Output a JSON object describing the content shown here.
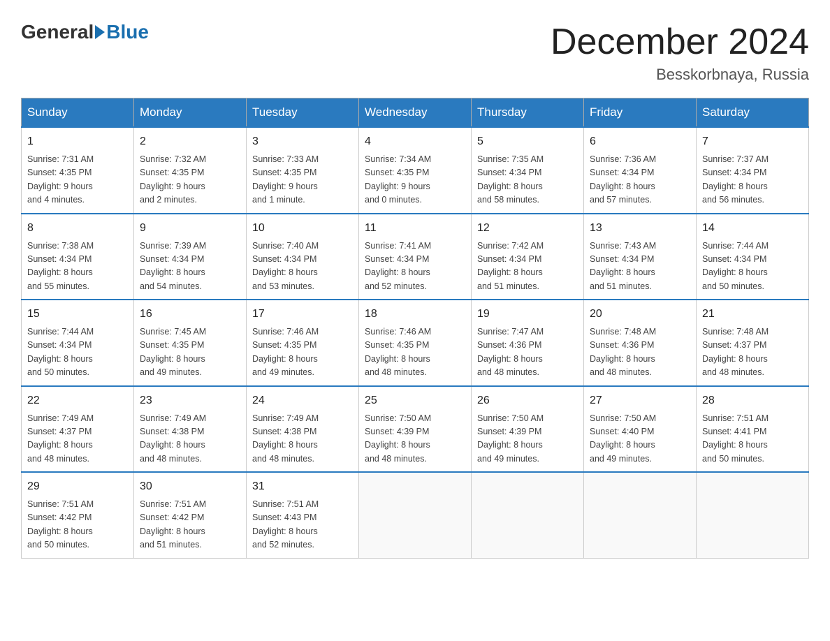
{
  "header": {
    "logo_general": "General",
    "logo_blue": "Blue",
    "month_title": "December 2024",
    "location": "Besskorbnaya, Russia"
  },
  "days_of_week": [
    "Sunday",
    "Monday",
    "Tuesday",
    "Wednesday",
    "Thursday",
    "Friday",
    "Saturday"
  ],
  "weeks": [
    [
      {
        "day": "1",
        "sunrise": "7:31 AM",
        "sunset": "4:35 PM",
        "daylight": "9 hours and 4 minutes."
      },
      {
        "day": "2",
        "sunrise": "7:32 AM",
        "sunset": "4:35 PM",
        "daylight": "9 hours and 2 minutes."
      },
      {
        "day": "3",
        "sunrise": "7:33 AM",
        "sunset": "4:35 PM",
        "daylight": "9 hours and 1 minute."
      },
      {
        "day": "4",
        "sunrise": "7:34 AM",
        "sunset": "4:35 PM",
        "daylight": "9 hours and 0 minutes."
      },
      {
        "day": "5",
        "sunrise": "7:35 AM",
        "sunset": "4:34 PM",
        "daylight": "8 hours and 58 minutes."
      },
      {
        "day": "6",
        "sunrise": "7:36 AM",
        "sunset": "4:34 PM",
        "daylight": "8 hours and 57 minutes."
      },
      {
        "day": "7",
        "sunrise": "7:37 AM",
        "sunset": "4:34 PM",
        "daylight": "8 hours and 56 minutes."
      }
    ],
    [
      {
        "day": "8",
        "sunrise": "7:38 AM",
        "sunset": "4:34 PM",
        "daylight": "8 hours and 55 minutes."
      },
      {
        "day": "9",
        "sunrise": "7:39 AM",
        "sunset": "4:34 PM",
        "daylight": "8 hours and 54 minutes."
      },
      {
        "day": "10",
        "sunrise": "7:40 AM",
        "sunset": "4:34 PM",
        "daylight": "8 hours and 53 minutes."
      },
      {
        "day": "11",
        "sunrise": "7:41 AM",
        "sunset": "4:34 PM",
        "daylight": "8 hours and 52 minutes."
      },
      {
        "day": "12",
        "sunrise": "7:42 AM",
        "sunset": "4:34 PM",
        "daylight": "8 hours and 51 minutes."
      },
      {
        "day": "13",
        "sunrise": "7:43 AM",
        "sunset": "4:34 PM",
        "daylight": "8 hours and 51 minutes."
      },
      {
        "day": "14",
        "sunrise": "7:44 AM",
        "sunset": "4:34 PM",
        "daylight": "8 hours and 50 minutes."
      }
    ],
    [
      {
        "day": "15",
        "sunrise": "7:44 AM",
        "sunset": "4:34 PM",
        "daylight": "8 hours and 50 minutes."
      },
      {
        "day": "16",
        "sunrise": "7:45 AM",
        "sunset": "4:35 PM",
        "daylight": "8 hours and 49 minutes."
      },
      {
        "day": "17",
        "sunrise": "7:46 AM",
        "sunset": "4:35 PM",
        "daylight": "8 hours and 49 minutes."
      },
      {
        "day": "18",
        "sunrise": "7:46 AM",
        "sunset": "4:35 PM",
        "daylight": "8 hours and 48 minutes."
      },
      {
        "day": "19",
        "sunrise": "7:47 AM",
        "sunset": "4:36 PM",
        "daylight": "8 hours and 48 minutes."
      },
      {
        "day": "20",
        "sunrise": "7:48 AM",
        "sunset": "4:36 PM",
        "daylight": "8 hours and 48 minutes."
      },
      {
        "day": "21",
        "sunrise": "7:48 AM",
        "sunset": "4:37 PM",
        "daylight": "8 hours and 48 minutes."
      }
    ],
    [
      {
        "day": "22",
        "sunrise": "7:49 AM",
        "sunset": "4:37 PM",
        "daylight": "8 hours and 48 minutes."
      },
      {
        "day": "23",
        "sunrise": "7:49 AM",
        "sunset": "4:38 PM",
        "daylight": "8 hours and 48 minutes."
      },
      {
        "day": "24",
        "sunrise": "7:49 AM",
        "sunset": "4:38 PM",
        "daylight": "8 hours and 48 minutes."
      },
      {
        "day": "25",
        "sunrise": "7:50 AM",
        "sunset": "4:39 PM",
        "daylight": "8 hours and 48 minutes."
      },
      {
        "day": "26",
        "sunrise": "7:50 AM",
        "sunset": "4:39 PM",
        "daylight": "8 hours and 49 minutes."
      },
      {
        "day": "27",
        "sunrise": "7:50 AM",
        "sunset": "4:40 PM",
        "daylight": "8 hours and 49 minutes."
      },
      {
        "day": "28",
        "sunrise": "7:51 AM",
        "sunset": "4:41 PM",
        "daylight": "8 hours and 50 minutes."
      }
    ],
    [
      {
        "day": "29",
        "sunrise": "7:51 AM",
        "sunset": "4:42 PM",
        "daylight": "8 hours and 50 minutes."
      },
      {
        "day": "30",
        "sunrise": "7:51 AM",
        "sunset": "4:42 PM",
        "daylight": "8 hours and 51 minutes."
      },
      {
        "day": "31",
        "sunrise": "7:51 AM",
        "sunset": "4:43 PM",
        "daylight": "8 hours and 52 minutes."
      },
      null,
      null,
      null,
      null
    ]
  ],
  "labels": {
    "sunrise": "Sunrise:",
    "sunset": "Sunset:",
    "daylight": "Daylight:"
  }
}
